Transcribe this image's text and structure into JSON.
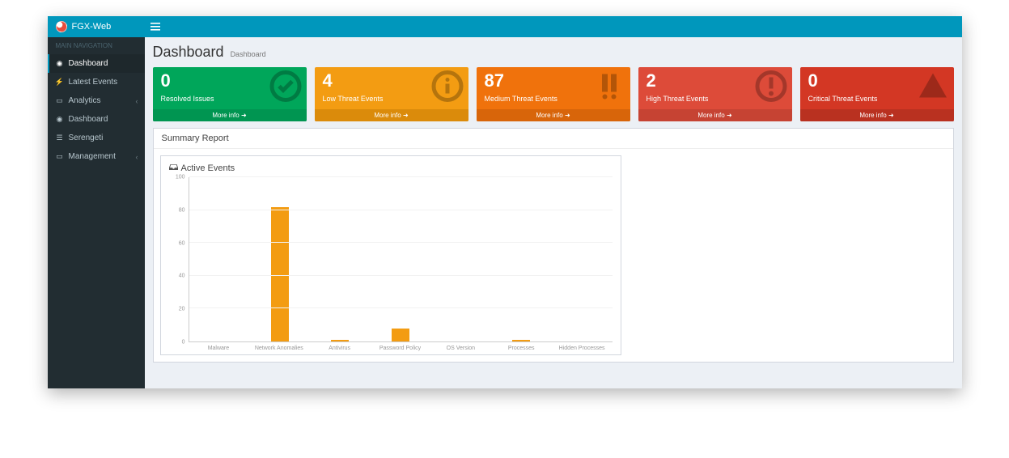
{
  "brand": "FGX-Web",
  "sidebar": {
    "section": "MAIN NAVIGATION",
    "items": [
      {
        "label": "Dashboard"
      },
      {
        "label": "Latest Events"
      },
      {
        "label": "Analytics"
      },
      {
        "label": "Dashboard"
      },
      {
        "label": "Serengeti"
      },
      {
        "label": "Management"
      }
    ]
  },
  "page": {
    "title": "Dashboard",
    "subtitle": "Dashboard",
    "more_info": "More info"
  },
  "stats": [
    {
      "value": "0",
      "label": "Resolved Issues",
      "bg": "#00a65a",
      "footer_bg": "#009551"
    },
    {
      "value": "4",
      "label": "Low Threat Events",
      "bg": "#f39c12",
      "footer_bg": "#db8b0b"
    },
    {
      "value": "87",
      "label": "Medium Threat Events",
      "bg": "#f0720c",
      "footer_bg": "#d8650a"
    },
    {
      "value": "2",
      "label": "High Threat Events",
      "bg": "#dd4b39",
      "footer_bg": "#c64333"
    },
    {
      "value": "0",
      "label": "Critical Threat Events",
      "bg": "#d33724",
      "footer_bg": "#b93120"
    }
  ],
  "summary": {
    "title": "Summary Report",
    "chart_title": "Active Events"
  },
  "chart_data": {
    "type": "bar",
    "categories": [
      "Malware",
      "Network Anomalies",
      "Antivirus",
      "Password Policy",
      "OS Version",
      "Processes",
      "Hidden Processes"
    ],
    "values": [
      0,
      82,
      1,
      8,
      0,
      1,
      0
    ],
    "ylim": [
      0,
      100
    ],
    "yticks": [
      0,
      20,
      40,
      60,
      80,
      100
    ],
    "bar_color": "#f39c12"
  }
}
